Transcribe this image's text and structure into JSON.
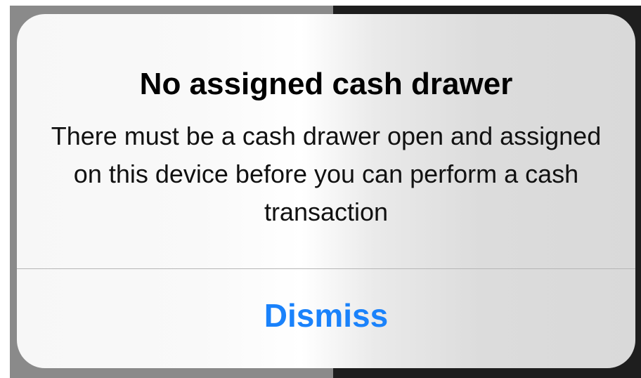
{
  "alert": {
    "title": "No assigned cash drawer",
    "message": "There must be a cash drawer open and assigned on this device before you can perform a cash transaction",
    "dismiss_label": "Dismiss"
  },
  "colors": {
    "button_text": "#1a82fb",
    "backdrop_left": "#8a8a8a",
    "backdrop_right": "#1e1e1e"
  }
}
